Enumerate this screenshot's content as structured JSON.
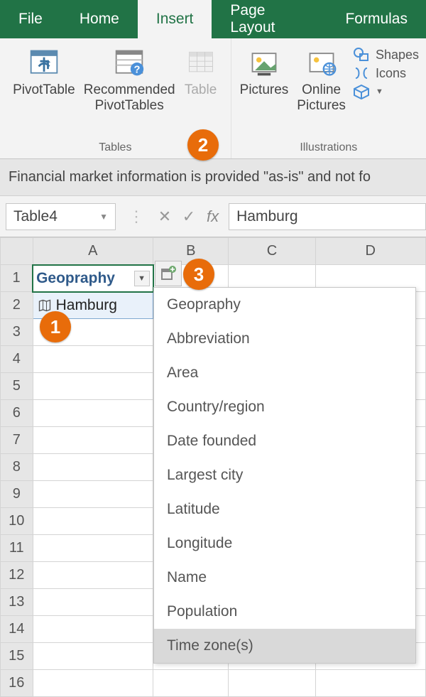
{
  "ribbon": {
    "tabs": [
      "File",
      "Home",
      "Insert",
      "Page Layout",
      "Formulas"
    ],
    "active_tab": "Insert",
    "groups": {
      "tables": {
        "label": "Tables",
        "pivottable": "PivotTable",
        "recommended": "Recommended\nPivotTables",
        "table": "Table"
      },
      "illustrations": {
        "label": "Illustrations",
        "pictures": "Pictures",
        "online_pictures": "Online\nPictures",
        "shapes": "Shapes",
        "icons": "Icons"
      }
    }
  },
  "message_bar": "Financial market information is provided \"as-is\" and not fo",
  "name_box": "Table4",
  "formula_bar": {
    "fx_label": "fx",
    "content": "Hamburg"
  },
  "grid": {
    "columns": [
      "A",
      "B",
      "C",
      "D"
    ],
    "row_count": 16,
    "a1_header": "Geopraphy",
    "a2_value": "Hamburg"
  },
  "dropdown_items": [
    "Geopraphy",
    "Abbreviation",
    "Area",
    "Country/region",
    "Date founded",
    "Largest city",
    "Latitude",
    "Longitude",
    "Name",
    "Population",
    "Time zone(s)"
  ],
  "dropdown_selected_index": 10,
  "annotations": {
    "b1": "1",
    "b2": "2",
    "b3": "3"
  }
}
